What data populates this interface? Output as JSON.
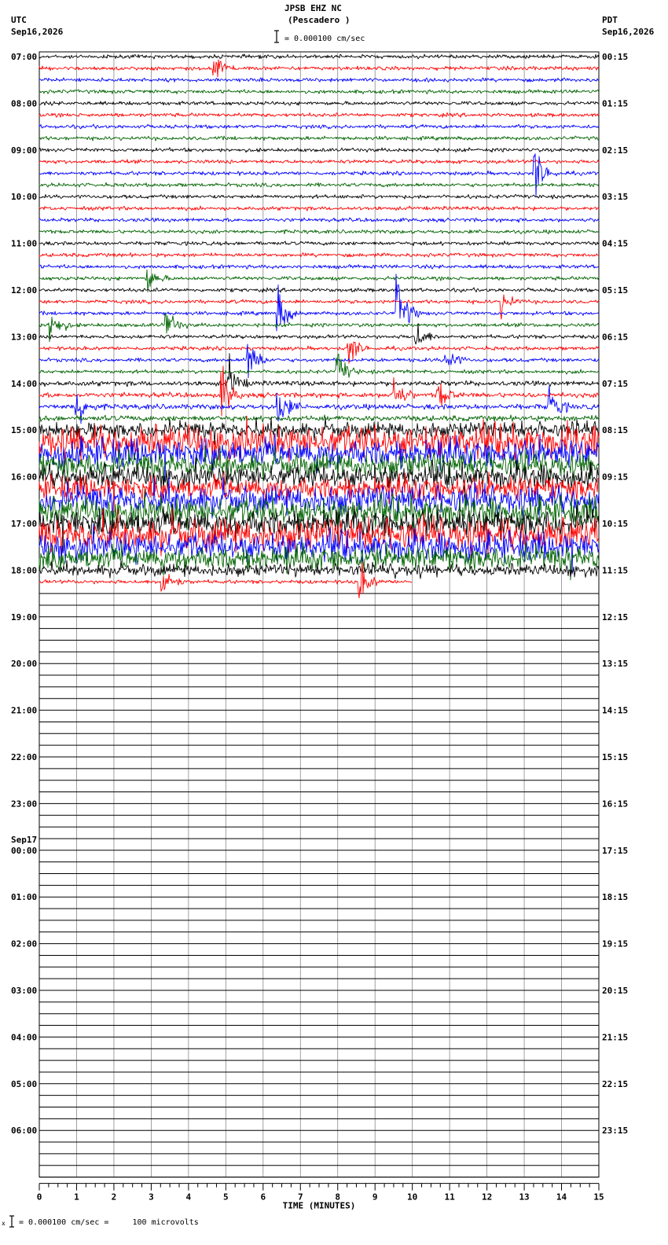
{
  "header": {
    "station": "JPSB EHZ NC",
    "location": "(Pescadero )",
    "scale_text": "= 0.000100 cm/sec",
    "left_zone": "UTC",
    "left_date": "Sep16,2026",
    "right_zone": "PDT",
    "right_date": "Sep16,2026"
  },
  "footer": {
    "scale_note": "= 0.000100 cm/sec =     100 microvolts"
  },
  "chart_data": {
    "type": "seismogram",
    "xlabel": "TIME (MINUTES)",
    "xlim": [
      0,
      15
    ],
    "x_ticks": [
      "0",
      "1",
      "2",
      "3",
      "4",
      "5",
      "6",
      "7",
      "8",
      "9",
      "10",
      "11",
      "12",
      "13",
      "14",
      "15"
    ],
    "rows_per_hour": 4,
    "minutes_per_row": 15,
    "trace_colors": [
      "#000000",
      "#ff0000",
      "#0000ff",
      "#006400"
    ],
    "date_change_label": "Sep17",
    "utc_hour_labels": [
      "07:00",
      "08:00",
      "09:00",
      "10:00",
      "11:00",
      "12:00",
      "13:00",
      "14:00",
      "15:00",
      "16:00",
      "17:00",
      "18:00",
      "19:00",
      "20:00",
      "21:00",
      "22:00",
      "23:00",
      "00:00",
      "01:00",
      "02:00",
      "03:00",
      "04:00",
      "05:00",
      "06:00"
    ],
    "pdt_hour_labels": [
      "00:15",
      "01:15",
      "02:15",
      "03:15",
      "04:15",
      "05:15",
      "06:15",
      "07:15",
      "08:15",
      "09:15",
      "10:15",
      "11:15",
      "12:15",
      "13:15",
      "14:15",
      "15:15",
      "16:15",
      "17:15",
      "18:15",
      "19:15",
      "20:15",
      "21:15",
      "22:15",
      "23:15"
    ],
    "recorded_rows": 46,
    "last_row_end_minute": 10,
    "row_noise_level": [
      1,
      1,
      1,
      1,
      1,
      1,
      1,
      1,
      1,
      1,
      1,
      1,
      1,
      1,
      1,
      1,
      1,
      1,
      1,
      1,
      1,
      1,
      1,
      1,
      1,
      1,
      1,
      1,
      1.3,
      1.3,
      1.4,
      1.5,
      4,
      8,
      7,
      6,
      6,
      6,
      7,
      7,
      7,
      8,
      7,
      6,
      3,
      1
    ],
    "events": [
      {
        "row": 1,
        "minute": 4.7,
        "amplitude": 2.5
      },
      {
        "row": 10,
        "minute": 13.3,
        "amplitude": 4
      },
      {
        "row": 19,
        "minute": 2.9,
        "amplitude": 2
      },
      {
        "row": 21,
        "minute": 12.4,
        "amplitude": 2
      },
      {
        "row": 22,
        "minute": 6.4,
        "amplitude": 4
      },
      {
        "row": 22,
        "minute": 9.6,
        "amplitude": 6
      },
      {
        "row": 23,
        "minute": 0.3,
        "amplitude": 3
      },
      {
        "row": 23,
        "minute": 3.4,
        "amplitude": 2.5
      },
      {
        "row": 24,
        "minute": 10.1,
        "amplitude": 2.5
      },
      {
        "row": 25,
        "minute": 8.3,
        "amplitude": 2.5
      },
      {
        "row": 26,
        "minute": 5.6,
        "amplitude": 4
      },
      {
        "row": 26,
        "minute": 10.9,
        "amplitude": 2.5
      },
      {
        "row": 27,
        "minute": 8.0,
        "amplitude": 3
      },
      {
        "row": 28,
        "minute": 5.1,
        "amplitude": 3
      },
      {
        "row": 29,
        "minute": 4.9,
        "amplitude": 4
      },
      {
        "row": 29,
        "minute": 9.5,
        "amplitude": 3
      },
      {
        "row": 29,
        "minute": 10.7,
        "amplitude": 2.5
      },
      {
        "row": 30,
        "minute": 1.0,
        "amplitude": 3.5
      },
      {
        "row": 30,
        "minute": 6.4,
        "amplitude": 3.5
      },
      {
        "row": 30,
        "minute": 13.7,
        "amplitude": 3
      },
      {
        "row": 45,
        "minute": 3.3,
        "amplitude": 3
      },
      {
        "row": 45,
        "minute": 8.6,
        "amplitude": 3
      }
    ]
  }
}
